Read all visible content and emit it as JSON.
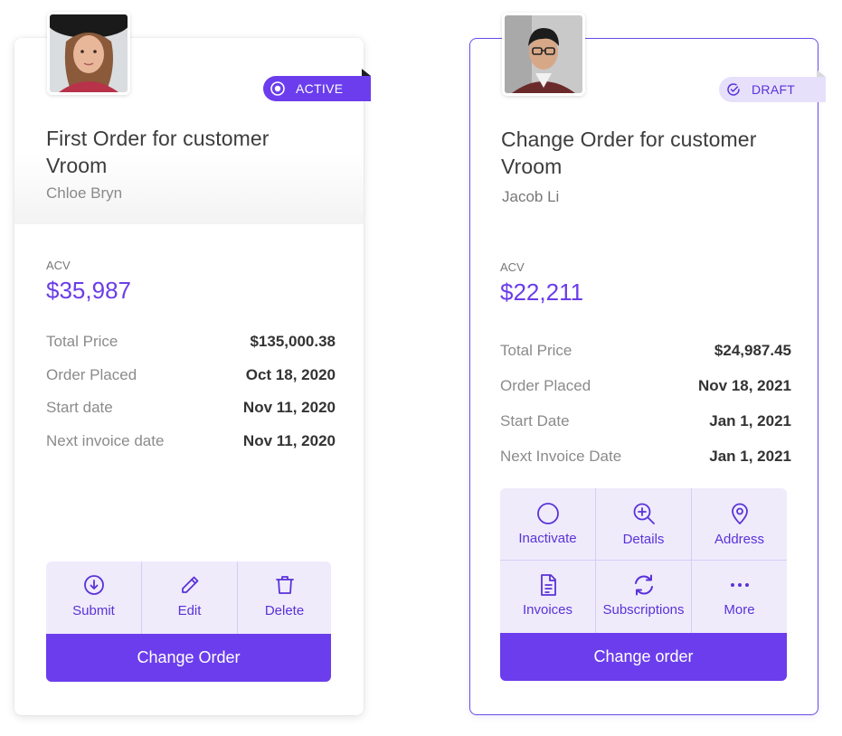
{
  "cards": [
    {
      "status": "ACTIVE",
      "title_line1": "First Order for customer",
      "title_line2": "Vroom",
      "customer": "Chloe Bryn",
      "acv_label": "ACV",
      "acv": "$35,987",
      "details": [
        {
          "label": "Total Price",
          "value": "$135,000.38"
        },
        {
          "label": "Order Placed",
          "value": "Oct 18, 2020"
        },
        {
          "label": "Start date",
          "value": "Nov 11, 2020"
        },
        {
          "label": "Next invoice date",
          "value": "Nov 11, 2020"
        }
      ],
      "actions": [
        {
          "label": "Submit",
          "icon": "download-circle-icon"
        },
        {
          "label": "Edit",
          "icon": "pencil-icon"
        },
        {
          "label": "Delete",
          "icon": "trash-icon"
        }
      ],
      "cta": "Change Order"
    },
    {
      "status": "DRAFT",
      "title_line1": "Change Order for customer",
      "title_line2": "Vroom",
      "customer": "Jacob Li",
      "acv_label": "ACV",
      "acv": "$22,211",
      "details": [
        {
          "label": "Total Price",
          "value": "$24,987.45"
        },
        {
          "label": "Order Placed",
          "value": "Nov 18, 2021"
        },
        {
          "label": "Start Date",
          "value": "Jan 1, 2021"
        },
        {
          "label": "Next Invoice Date",
          "value": "Jan 1, 2021"
        }
      ],
      "actions": [
        {
          "label": "Inactivate",
          "icon": "circle-icon"
        },
        {
          "label": "Details",
          "icon": "zoom-in-icon"
        },
        {
          "label": "Address",
          "icon": "map-pin-icon"
        },
        {
          "label": "Invoices",
          "icon": "document-icon"
        },
        {
          "label": "Subscriptions",
          "icon": "refresh-icon"
        },
        {
          "label": "More",
          "icon": "more-dots-icon"
        }
      ],
      "cta": "Change order"
    }
  ],
  "colors": {
    "accent": "#6b3ded",
    "accent_text": "#5a32d8",
    "action_bg": "#efebfb",
    "draft_badge_bg": "#e6e0fb"
  }
}
